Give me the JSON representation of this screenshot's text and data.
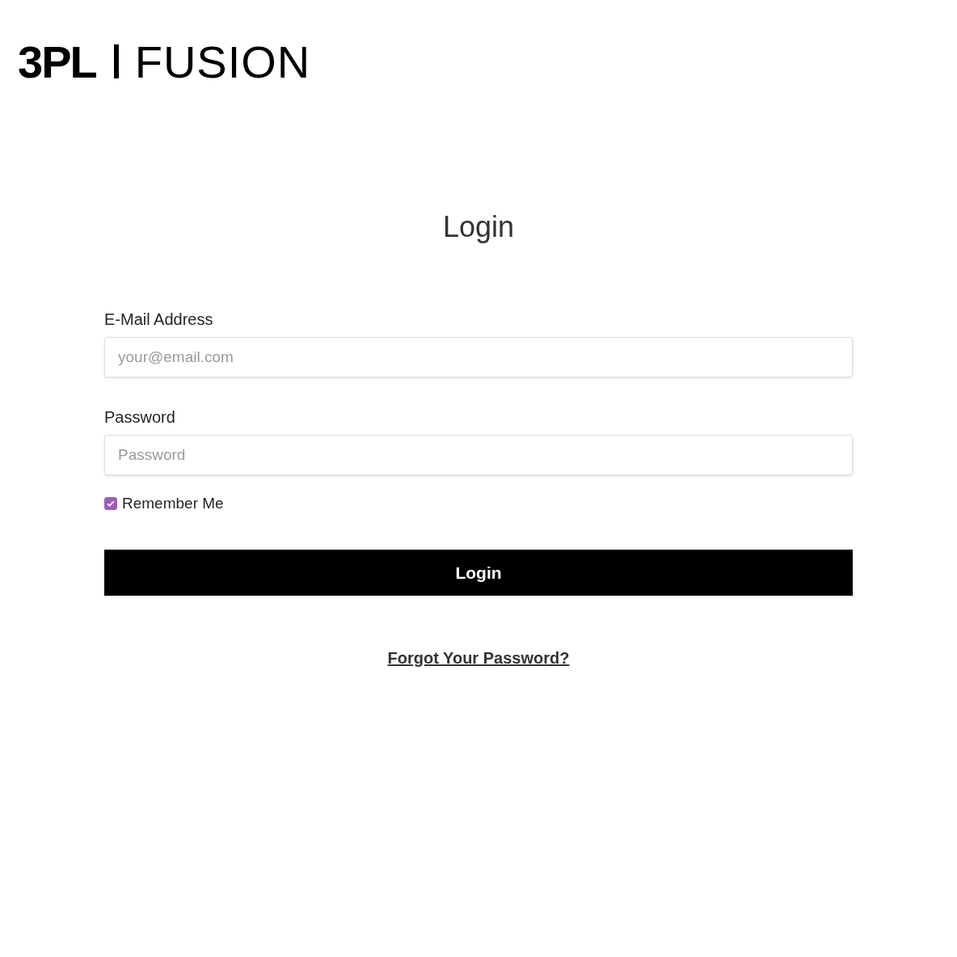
{
  "logo": {
    "brand": "3PL",
    "product": "FUSION"
  },
  "title": "Login",
  "fields": [
    {
      "label": "E-Mail Address",
      "placeholder": "your@email.com"
    },
    {
      "label": "Password",
      "placeholder": "Password"
    }
  ],
  "remember": {
    "label": "Remember Me",
    "checked": true
  },
  "button": "Login",
  "forgot_link": "Forgot Your Password?"
}
